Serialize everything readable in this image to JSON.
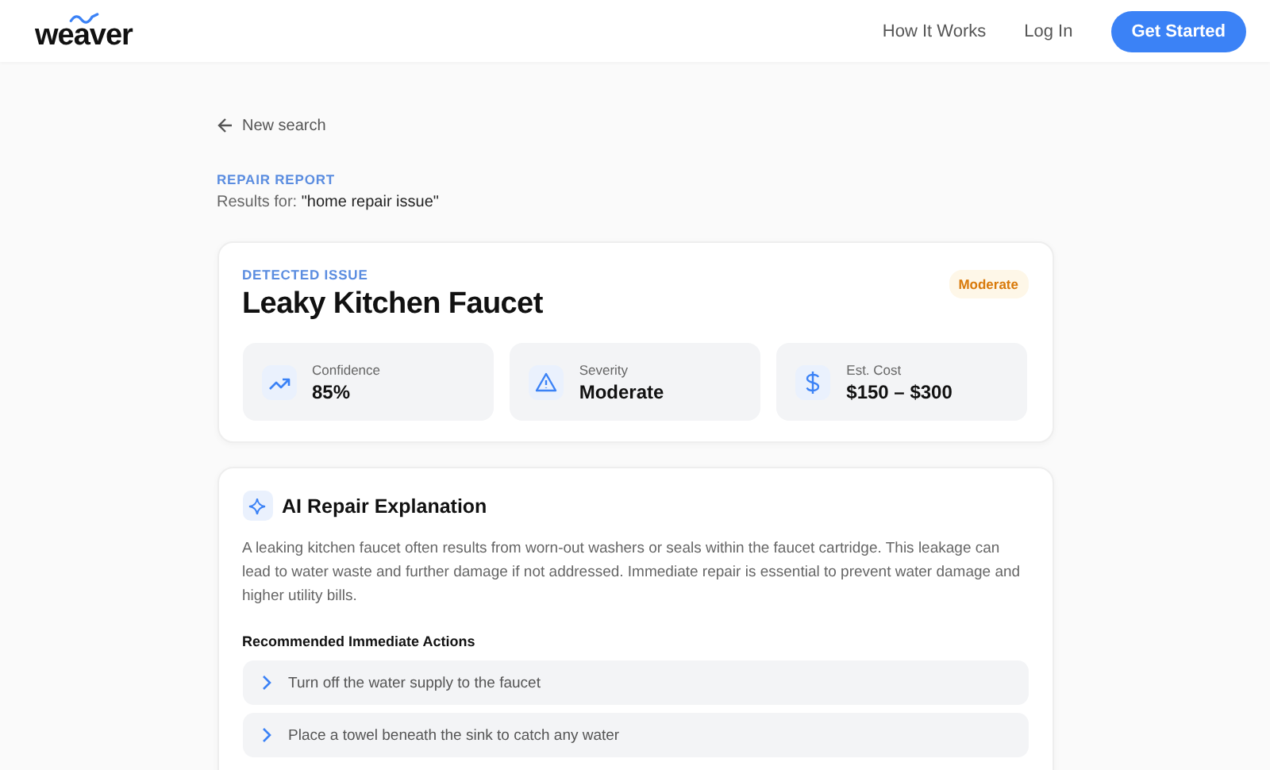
{
  "brand": {
    "name": "weaver"
  },
  "nav": {
    "links": [
      "How It Works",
      "Log In"
    ],
    "cta": "Get Started"
  },
  "back_link": "New search",
  "report": {
    "eyebrow": "REPAIR REPORT",
    "results_label": "Results for:",
    "query": "\"home repair issue\""
  },
  "issue": {
    "eyebrow": "DETECTED ISSUE",
    "title": "Leaky Kitchen Faucet",
    "badge": "Moderate",
    "stats": [
      {
        "kind": "trend",
        "label": "Confidence",
        "value": "85%"
      },
      {
        "kind": "warning",
        "label": "Severity",
        "value": "Moderate"
      },
      {
        "kind": "dollar",
        "label": "Est. Cost",
        "value": "$150 – $300"
      }
    ]
  },
  "explanation": {
    "title": "AI Repair Explanation",
    "text": "A leaking kitchen faucet often results from worn-out washers or seals within the faucet cartridge. This leakage can lead to water waste and further damage if not addressed. Immediate repair is essential to prevent water damage and higher utility bills.",
    "actions_title": "Recommended Immediate Actions",
    "actions": [
      "Turn off the water supply to the faucet",
      "Place a towel beneath the sink to catch any water"
    ]
  }
}
